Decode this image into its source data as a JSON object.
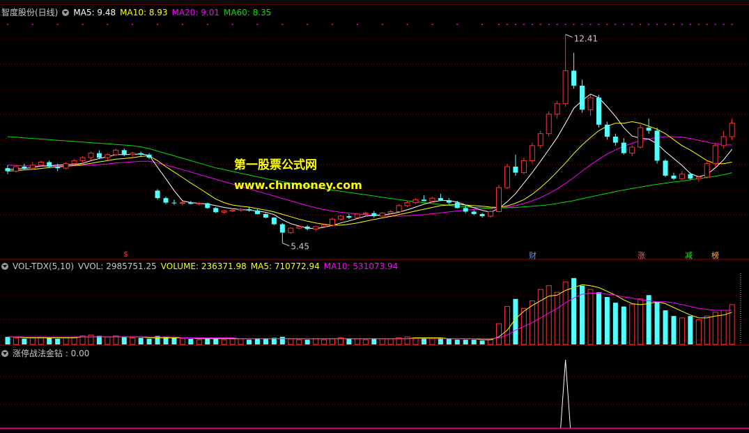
{
  "main_pane": {
    "title": "智度股份(日线)",
    "ma_labels": [
      {
        "text": "MA5: 9.48",
        "color": "#ffffff"
      },
      {
        "text": "MA10: 8.93",
        "color": "#ffff00"
      },
      {
        "text": "MA20: 9.01",
        "color": "#ff00ff"
      },
      {
        "text": "MA60: 8.35",
        "color": "#00e000"
      }
    ],
    "high_label": "12.41",
    "low_label": "5.45",
    "watermark_line1": "第一股票公式网",
    "watermark_line2": "www.chnmoney.com",
    "markers": [
      {
        "text": "$",
        "color": "#ff3030"
      },
      {
        "text": "财",
        "color": "#4aa0ff"
      },
      {
        "text": "涨",
        "color": "#ff6060"
      },
      {
        "text": "减",
        "color": "#30e030"
      },
      {
        "text": "榜",
        "color": "#ffb040"
      }
    ]
  },
  "volume_pane": {
    "labels": [
      {
        "text": "VOL-TDX(5,10)",
        "color": "#c8c8c8"
      },
      {
        "text": "VVOL: 2985751.25",
        "color": "#c8c8c8"
      },
      {
        "text": "VOLUME: 236371.98",
        "color": "#ffff00"
      },
      {
        "text": "MA5: 710772.94",
        "color": "#ffff00"
      },
      {
        "text": "MA10: 531073.94",
        "color": "#ff00ff"
      }
    ]
  },
  "indicator_pane": {
    "label": "涨停战法金钻 : 0.00"
  },
  "colors": {
    "up": "#ff3232",
    "down": "#54ffff",
    "ma5": "#ffffff",
    "ma10": "#ffff00",
    "ma20": "#ff00ff",
    "ma60": "#00e000",
    "grid": "#8a0000",
    "border": "#a00000"
  },
  "chart_data": {
    "type": "candlestick",
    "ylim": [
      5,
      13
    ],
    "candles": [
      [
        7.95,
        8.05,
        7.75,
        7.85
      ],
      [
        7.85,
        8.05,
        7.8,
        8.0
      ],
      [
        8.0,
        8.1,
        7.9,
        7.95
      ],
      [
        7.95,
        8.15,
        7.9,
        8.05
      ],
      [
        8.05,
        8.2,
        8.0,
        8.15
      ],
      [
        8.15,
        8.2,
        7.95,
        8.0
      ],
      [
        8.0,
        8.1,
        7.85,
        7.95
      ],
      [
        7.95,
        8.15,
        7.9,
        8.1
      ],
      [
        8.1,
        8.25,
        8.05,
        8.2
      ],
      [
        8.2,
        8.35,
        8.1,
        8.3
      ],
      [
        8.3,
        8.5,
        8.2,
        8.45
      ],
      [
        8.45,
        8.55,
        8.25,
        8.3
      ],
      [
        8.3,
        8.45,
        8.2,
        8.4
      ],
      [
        8.4,
        8.6,
        8.35,
        8.55
      ],
      [
        8.55,
        8.6,
        8.35,
        8.4
      ],
      [
        8.4,
        8.5,
        8.3,
        8.45
      ],
      [
        8.45,
        8.5,
        8.35,
        8.4
      ],
      [
        8.4,
        8.45,
        8.25,
        8.3
      ],
      [
        7.2,
        7.25,
        6.9,
        6.95
      ],
      [
        6.95,
        7.0,
        6.75,
        6.8
      ],
      [
        6.8,
        6.9,
        6.72,
        6.78
      ],
      [
        6.78,
        6.85,
        6.7,
        6.8
      ],
      [
        6.8,
        6.86,
        6.74,
        6.76
      ],
      [
        6.76,
        6.82,
        6.7,
        6.78
      ],
      [
        6.78,
        6.8,
        6.6,
        6.62
      ],
      [
        6.62,
        6.65,
        6.45,
        6.48
      ],
      [
        6.48,
        6.55,
        6.42,
        6.52
      ],
      [
        6.52,
        6.6,
        6.48,
        6.55
      ],
      [
        6.55,
        6.62,
        6.5,
        6.58
      ],
      [
        6.58,
        6.64,
        6.5,
        6.54
      ],
      [
        6.54,
        6.58,
        6.4,
        6.42
      ],
      [
        6.42,
        6.45,
        6.28,
        6.3
      ],
      [
        6.3,
        6.32,
        6.05,
        6.08
      ],
      [
        6.08,
        6.12,
        5.45,
        5.8
      ],
      [
        5.8,
        5.98,
        5.75,
        5.95
      ],
      [
        5.95,
        6.05,
        5.9,
        6.0
      ],
      [
        6.0,
        6.05,
        5.88,
        5.92
      ],
      [
        5.92,
        6.02,
        5.85,
        6.0
      ],
      [
        6.0,
        6.1,
        5.95,
        6.05
      ],
      [
        6.05,
        6.3,
        6.0,
        6.25
      ],
      [
        6.25,
        6.4,
        6.2,
        6.35
      ],
      [
        6.35,
        6.42,
        6.25,
        6.3
      ],
      [
        6.3,
        6.45,
        6.28,
        6.42
      ],
      [
        6.42,
        6.5,
        6.35,
        6.45
      ],
      [
        6.45,
        6.52,
        6.3,
        6.35
      ],
      [
        6.35,
        6.48,
        6.32,
        6.45
      ],
      [
        6.45,
        6.55,
        6.4,
        6.5
      ],
      [
        6.5,
        6.75,
        6.45,
        6.7
      ],
      [
        6.7,
        6.85,
        6.65,
        6.8
      ],
      [
        6.8,
        6.95,
        6.75,
        6.9
      ],
      [
        6.9,
        7.05,
        6.85,
        6.85
      ],
      [
        6.85,
        7.0,
        6.8,
        6.95
      ],
      [
        6.95,
        7.1,
        6.85,
        6.88
      ],
      [
        6.88,
        6.95,
        6.75,
        6.8
      ],
      [
        6.8,
        6.86,
        6.6,
        6.62
      ],
      [
        6.62,
        6.7,
        6.45,
        6.5
      ],
      [
        6.5,
        6.55,
        6.38,
        6.42
      ],
      [
        6.42,
        6.45,
        6.3,
        6.35
      ],
      [
        6.35,
        6.55,
        6.3,
        6.5
      ],
      [
        6.5,
        7.4,
        6.48,
        7.3
      ],
      [
        7.3,
        8.1,
        7.25,
        8.0
      ],
      [
        8.0,
        8.4,
        7.7,
        7.8
      ],
      [
        7.8,
        8.3,
        7.75,
        8.2
      ],
      [
        8.2,
        8.8,
        8.1,
        8.7
      ],
      [
        8.7,
        9.2,
        8.6,
        9.1
      ],
      [
        9.1,
        9.85,
        9.0,
        9.75
      ],
      [
        9.75,
        10.2,
        9.6,
        10.1
      ],
      [
        10.1,
        12.41,
        10.0,
        11.2
      ],
      [
        11.2,
        11.8,
        10.6,
        10.7
      ],
      [
        10.7,
        10.9,
        9.8,
        9.9
      ],
      [
        9.9,
        10.4,
        9.7,
        10.3
      ],
      [
        10.3,
        10.4,
        9.3,
        9.4
      ],
      [
        9.4,
        9.5,
        8.9,
        9.0
      ],
      [
        9.0,
        9.1,
        8.7,
        8.8
      ],
      [
        8.8,
        8.95,
        8.4,
        8.45
      ],
      [
        8.45,
        8.7,
        8.35,
        8.65
      ],
      [
        8.65,
        9.4,
        8.6,
        9.3
      ],
      [
        9.3,
        9.6,
        9.1,
        9.2
      ],
      [
        9.2,
        9.3,
        8.1,
        8.2
      ],
      [
        8.2,
        8.25,
        7.65,
        7.7
      ],
      [
        7.7,
        7.8,
        7.55,
        7.6
      ],
      [
        7.6,
        7.85,
        7.55,
        7.75
      ],
      [
        7.75,
        7.8,
        7.55,
        7.6
      ],
      [
        7.6,
        7.7,
        7.5,
        7.65
      ],
      [
        7.65,
        8.2,
        7.6,
        8.1
      ],
      [
        8.1,
        8.8,
        8.0,
        8.7
      ],
      [
        8.7,
        9.2,
        8.6,
        9.0
      ],
      [
        9.0,
        9.6,
        8.9,
        9.45
      ]
    ],
    "ma5": [
      7.9,
      7.92,
      7.94,
      7.97,
      8.02,
      8.03,
      8.05,
      8.06,
      8.08,
      8.11,
      8.2,
      8.27,
      8.33,
      8.4,
      8.4,
      8.41,
      8.42,
      8.38,
      7.98,
      7.6,
      7.2,
      6.86,
      6.8,
      6.78,
      6.75,
      6.7,
      6.64,
      6.6,
      6.57,
      6.55,
      6.52,
      6.48,
      6.4,
      6.23,
      6.1,
      6.02,
      5.95,
      5.93,
      5.98,
      6.04,
      6.12,
      6.19,
      6.27,
      6.35,
      6.38,
      6.39,
      6.42,
      6.48,
      6.56,
      6.65,
      6.75,
      6.82,
      6.87,
      6.87,
      6.82,
      6.72,
      6.63,
      6.54,
      6.48,
      6.61,
      6.83,
      7.1,
      7.45,
      7.8,
      8.18,
      8.57,
      8.97,
      9.45,
      9.95,
      10.2,
      10.42,
      10.3,
      10.0,
      9.68,
      9.3,
      9.02,
      8.95,
      8.92,
      8.76,
      8.5,
      8.27,
      8.04,
      7.77,
      7.66,
      7.74,
      7.96,
      8.23,
      8.58
    ],
    "ma10": [
      7.85,
      7.87,
      7.89,
      7.91,
      7.94,
      7.97,
      7.99,
      8.01,
      8.04,
      8.07,
      8.11,
      8.16,
      8.2,
      8.25,
      8.27,
      8.3,
      8.34,
      8.36,
      8.2,
      8.0,
      7.82,
      7.64,
      7.45,
      7.28,
      7.1,
      6.92,
      6.8,
      6.72,
      6.68,
      6.65,
      6.6,
      6.55,
      6.49,
      6.41,
      6.33,
      6.25,
      6.18,
      6.12,
      6.08,
      6.05,
      6.05,
      6.08,
      6.12,
      6.18,
      6.24,
      6.29,
      6.34,
      6.4,
      6.46,
      6.52,
      6.58,
      6.64,
      6.7,
      6.72,
      6.74,
      6.72,
      6.7,
      6.68,
      6.65,
      6.64,
      6.69,
      6.78,
      6.9,
      7.08,
      7.3,
      7.55,
      7.83,
      8.12,
      8.44,
      8.72,
      8.97,
      9.2,
      9.35,
      9.45,
      9.45,
      9.5,
      9.45,
      9.35,
      9.25,
      9.1,
      8.9,
      8.7,
      8.55,
      8.38,
      8.2,
      8.1,
      8.1,
      8.15
    ],
    "ma20": [
      8.05,
      8.04,
      8.03,
      8.02,
      8.02,
      8.02,
      8.02,
      8.02,
      8.03,
      8.04,
      8.05,
      8.07,
      8.09,
      8.12,
      8.14,
      8.16,
      8.18,
      8.18,
      8.12,
      8.05,
      7.98,
      7.9,
      7.82,
      7.74,
      7.66,
      7.58,
      7.5,
      7.42,
      7.34,
      7.26,
      7.18,
      7.1,
      7.02,
      6.94,
      6.86,
      6.78,
      6.7,
      6.63,
      6.57,
      6.52,
      6.48,
      6.45,
      6.42,
      6.4,
      6.38,
      6.36,
      6.35,
      6.35,
      6.36,
      6.38,
      6.4,
      6.43,
      6.46,
      6.49,
      6.52,
      6.55,
      6.57,
      6.59,
      6.6,
      6.62,
      6.65,
      6.7,
      6.77,
      6.86,
      6.97,
      7.1,
      7.26,
      7.44,
      7.64,
      7.85,
      8.06,
      8.25,
      8.42,
      8.56,
      8.68,
      8.78,
      8.86,
      8.92,
      8.97,
      9.0,
      9.0,
      8.98,
      8.94,
      8.88,
      8.82,
      8.76,
      8.73,
      8.72
    ],
    "ma60": [
      9.0,
      8.98,
      8.96,
      8.94,
      8.92,
      8.9,
      8.88,
      8.86,
      8.84,
      8.82,
      8.8,
      8.78,
      8.76,
      8.74,
      8.72,
      8.7,
      8.66,
      8.6,
      8.52,
      8.44,
      8.36,
      8.28,
      8.2,
      8.12,
      8.04,
      7.96,
      7.9,
      7.84,
      7.78,
      7.72,
      7.66,
      7.6,
      7.55,
      7.5,
      7.45,
      7.4,
      7.35,
      7.3,
      7.26,
      7.22,
      7.18,
      7.14,
      7.1,
      7.06,
      7.02,
      6.98,
      6.94,
      6.9,
      6.86,
      6.83,
      6.8,
      6.77,
      6.74,
      6.71,
      6.68,
      6.66,
      6.64,
      6.63,
      6.62,
      6.62,
      6.63,
      6.64,
      6.66,
      6.68,
      6.7,
      6.73,
      6.77,
      6.82,
      6.87,
      6.93,
      6.99,
      7.05,
      7.11,
      7.17,
      7.22,
      7.27,
      7.32,
      7.37,
      7.41,
      7.45,
      7.49,
      7.52,
      7.56,
      7.6,
      7.64,
      7.68,
      7.73,
      7.8
    ],
    "volume": [
      8,
      7,
      6,
      7,
      8,
      7,
      6,
      7,
      8,
      9,
      10,
      9,
      8,
      9,
      8,
      7,
      7,
      6,
      9,
      8,
      7,
      6,
      6,
      5,
      6,
      6,
      5,
      6,
      6,
      5,
      6,
      6,
      7,
      8,
      6,
      5,
      5,
      6,
      5,
      6,
      7,
      6,
      6,
      5,
      6,
      6,
      6,
      7,
      8,
      7,
      7,
      6,
      7,
      6,
      5,
      5,
      5,
      4,
      5,
      22,
      40,
      48,
      38,
      46,
      58,
      62,
      55,
      66,
      70,
      62,
      58,
      55,
      50,
      44,
      40,
      42,
      48,
      52,
      45,
      36,
      30,
      28,
      30,
      26,
      30,
      34,
      36,
      42
    ],
    "volume_ma5": [
      8,
      8,
      7,
      7,
      7,
      7,
      7,
      7,
      7,
      8,
      8,
      8,
      8,
      8,
      8,
      8,
      8,
      7,
      7,
      7,
      7,
      7,
      7,
      6,
      6,
      6,
      6,
      6,
      6,
      6,
      6,
      6,
      6,
      6,
      6,
      6,
      6,
      6,
      6,
      6,
      6,
      6,
      6,
      6,
      6,
      6,
      6,
      6,
      6,
      7,
      7,
      7,
      7,
      6,
      6,
      6,
      6,
      5,
      5,
      8,
      15,
      27,
      35,
      41,
      46,
      51,
      52,
      57,
      60,
      63,
      62,
      60,
      56,
      52,
      47,
      43,
      42,
      43,
      45,
      43,
      39,
      35,
      31,
      28,
      28,
      30,
      31,
      34
    ],
    "volume_ma10": [
      8,
      8,
      8,
      8,
      8,
      8,
      8,
      8,
      8,
      8,
      8,
      8,
      8,
      8,
      8,
      8,
      8,
      8,
      8,
      8,
      8,
      7,
      7,
      7,
      7,
      7,
      7,
      7,
      6,
      6,
      6,
      6,
      6,
      6,
      6,
      6,
      6,
      6,
      6,
      6,
      6,
      6,
      6,
      6,
      6,
      6,
      6,
      6,
      6,
      6,
      6,
      6,
      6,
      6,
      6,
      6,
      6,
      6,
      6,
      7,
      10,
      15,
      19,
      23,
      28,
      33,
      38,
      44,
      49,
      53,
      54,
      54,
      53,
      52,
      50,
      49,
      47,
      46,
      45,
      45,
      44,
      42,
      40,
      38,
      37,
      36,
      36,
      36
    ],
    "indicator": {
      "spike_index": 67
    }
  }
}
